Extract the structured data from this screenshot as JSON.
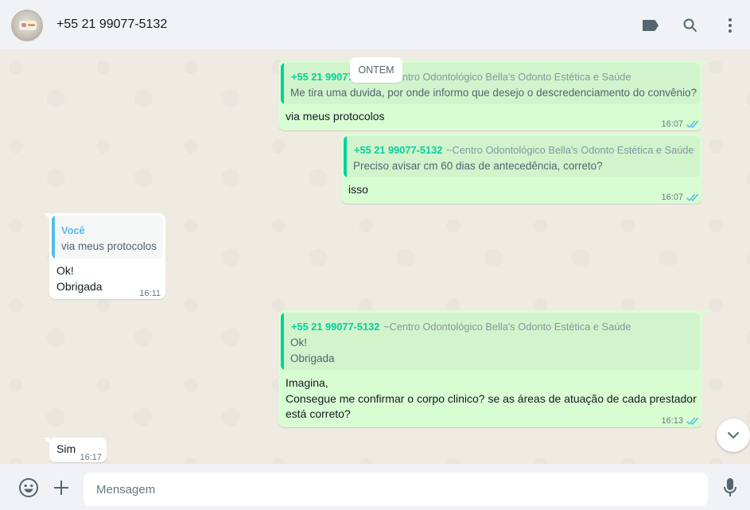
{
  "header": {
    "contact_name": "+55 21 99077-5132",
    "icons": [
      "label-icon",
      "search-icon",
      "menu-icon"
    ]
  },
  "date_chip": "ONTEM",
  "messages": [
    {
      "direction": "outgoing",
      "quote": {
        "sender": "+55 21 99077-5132",
        "group": "~Centro Odontológico Bella's Odonto Estética e Saúde",
        "text": "Me tira uma duvida, por onde informo que desejo  o descredenciamento do convênio?"
      },
      "text": "via meus protocolos",
      "time": "16:07",
      "status": "read"
    },
    {
      "direction": "outgoing",
      "quote": {
        "sender": "+55 21 99077-5132",
        "group": "~Centro Odontológico Bella's Odonto Estética e Saúde",
        "text": "Preciso avisar cm 60 dias de antecedência, correto?"
      },
      "text": "isso",
      "time": "16:07",
      "status": "read"
    },
    {
      "direction": "incoming",
      "quote": {
        "sender": "Você",
        "text": "via meus protocolos"
      },
      "text": "Ok!\nObrigada",
      "time": "16:11"
    },
    {
      "direction": "outgoing",
      "quote": {
        "sender": "+55 21 99077-5132",
        "group": "~Centro Odontológico Bella's Odonto Estética e Saúde",
        "text": "Ok!\nObrigada"
      },
      "text": "Imagina,\nConsegue me confirmar o corpo clinico? se as áreas de atuação de cada prestador\nestá correto?",
      "time": "16:13",
      "status": "read"
    },
    {
      "direction": "incoming",
      "text": "Sim",
      "time": "16:17"
    }
  ],
  "composer": {
    "placeholder": "Mensagem"
  },
  "colors": {
    "outgoing_bubble": "#d9fdd3",
    "incoming_bubble": "#ffffff",
    "quote_sender_out": "#06cf9c",
    "quote_sender_self": "#53bdeb",
    "read_ticks": "#53bdeb",
    "chat_background": "#efeae2"
  }
}
